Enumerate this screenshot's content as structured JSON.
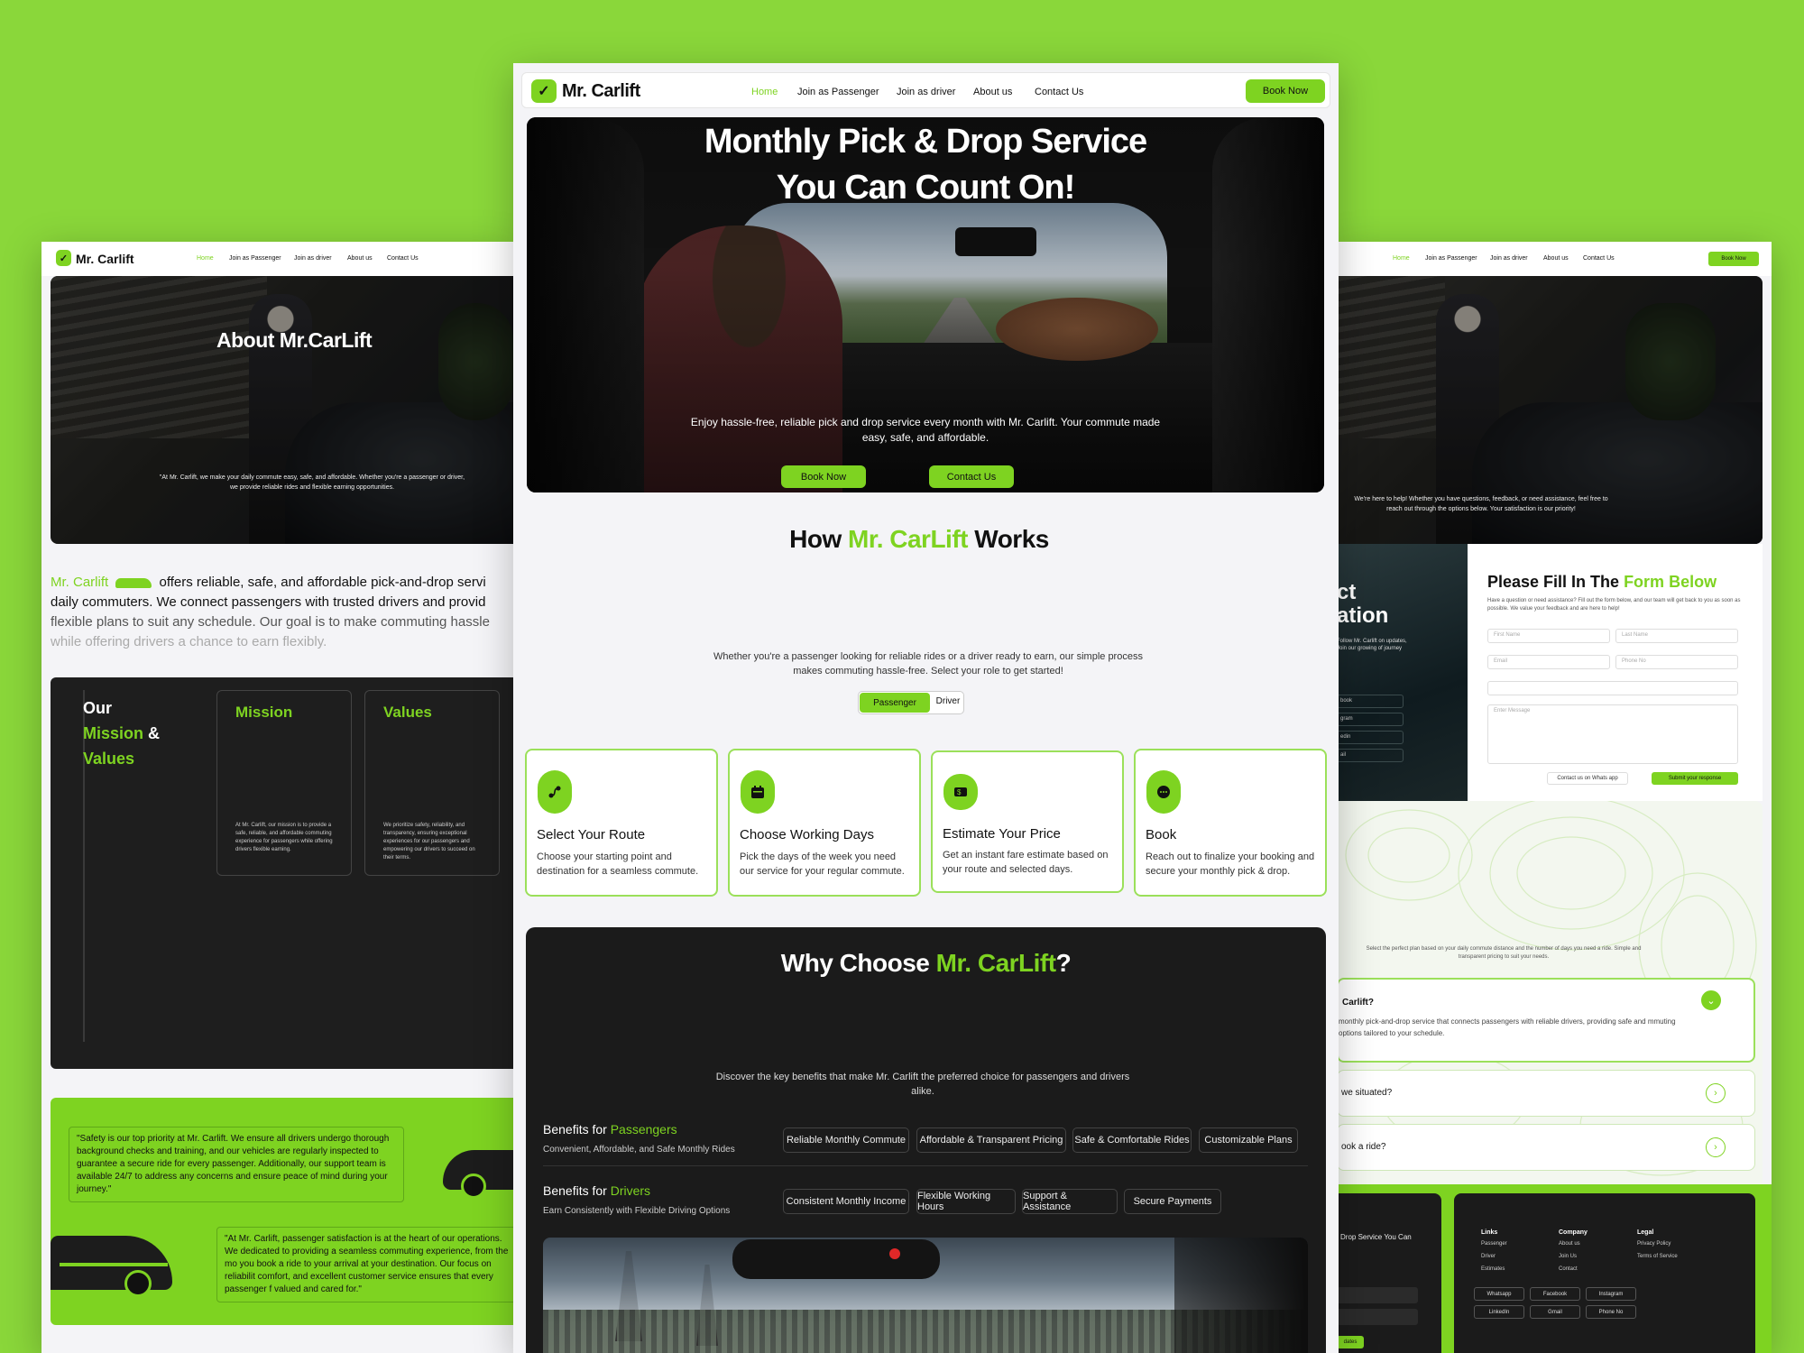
{
  "brand": {
    "name": "Mr. Carlift",
    "accent": "#7ed321",
    "dark": "#1b1b1b"
  },
  "nav": {
    "home": "Home",
    "passenger": "Join as Passenger",
    "driver": "Join as driver",
    "about": "About us",
    "contact": "Contact Us",
    "book": "Book Now"
  },
  "hero": {
    "title_line1": "Monthly Pick & Drop Service",
    "title_line2": "You Can Count On!",
    "subtitle": "Enjoy hassle-free, reliable pick and drop service every month with Mr. Carlift. Your commute made easy, safe, and affordable.",
    "btn_book": "Book Now",
    "btn_contact": "Contact Us"
  },
  "how": {
    "title_a": "How ",
    "title_b": "Mr. CarLift",
    "title_c": " Works",
    "desc": "Whether you're a passenger looking for reliable rides or a driver ready to earn, our simple process makes commuting hassle-free. Select your role to get started!",
    "toggle_passenger": "Passenger",
    "toggle_driver": "Driver",
    "steps": [
      {
        "title": "Select Your Route",
        "text": "Choose your starting point and destination for a seamless commute.",
        "icon": "route-icon"
      },
      {
        "title": "Choose Working Days",
        "text": "Pick the days of the week you need our service for your regular commute.",
        "icon": "calendar-icon"
      },
      {
        "title": "Estimate Your Price",
        "text": "Get an instant fare estimate based on your route and selected days.",
        "icon": "price-icon"
      },
      {
        "title": "Book",
        "text": "Reach out to finalize your booking and secure your monthly pick & drop.",
        "icon": "chat-icon"
      }
    ]
  },
  "why": {
    "title_a": "Why Choose ",
    "title_b": "Mr. CarLift",
    "title_c": "?",
    "desc": "Discover the key benefits that make Mr. Carlift the preferred choice for passengers and drivers alike.",
    "passengers_label_a": "Benefits for ",
    "passengers_label_b": "Passengers",
    "passengers_sub": "Convenient, Affordable, and Safe Monthly Rides",
    "passengers_pills": [
      "Reliable Monthly Commute",
      "Affordable & Transparent Pricing",
      "Safe & Comfortable Rides",
      "Customizable Plans"
    ],
    "drivers_label_a": "Benefits for ",
    "drivers_label_b": "Drivers",
    "drivers_sub": "Earn Consistently with Flexible Driving Options",
    "drivers_pills": [
      "Consistent Monthly Income",
      "Flexible Working Hours",
      "Support & Assistance",
      "Secure Payments"
    ]
  },
  "about": {
    "title": "About Mr.CarLift",
    "hero_text": "\"At Mr. Carlift, we make your daily commute easy, safe, and affordable. Whether you're a passenger or driver, we provide reliable rides and flexible earning opportunities.",
    "intro_brand": "Mr. Carlift",
    "intro_l1": "offers reliable, safe, and affordable pick-and-drop servi",
    "intro_l2": "daily commuters. We connect passengers with trusted drivers and provid",
    "intro_l3": "flexible plans to suit any schedule. Our goal is to make commuting hassle",
    "intro_l4": "while offering drivers a chance to earn flexibly.",
    "mv_our": "Our",
    "mv_mission": "Mission",
    "mv_amp": "&",
    "mv_values": "Values",
    "mission_title": "Mission",
    "mission_text": "At Mr. Carlift, our mission is to provide a safe, reliable, and affordable commuting experience for passengers while offering drivers flexible earning.",
    "values_title": "Values",
    "values_text": "We prioritize safety, reliability, and transparency, ensuring exceptional experiences for our passengers and empowering our drivers to succeed on their terms.",
    "quote1": "\"Safety is our top priority at Mr. Carlift. We ensure all drivers undergo thorough background checks and training, and our vehicles are regularly inspected to guarantee a secure ride for every passenger. Additionally, our support team is available 24/7 to address any concerns and ensure peace of mind during your journey.\"",
    "quote2": "\"At Mr. Carlift, passenger satisfaction is at the heart of our operations. We dedicated to providing a seamless commuting experience, from the mo you book a ride to your arrival at your destination. Our focus on reliabilit comfort, and excellent customer service ensures that every passenger f valued and cared for.\""
  },
  "contact": {
    "hero_text": "We're here to help! Whether you have questions, feedback, or need assistance, feel free to reach out through the options below. Your satisfaction is our priority!",
    "side_title_1": "ct",
    "side_title_2": "ation",
    "side_text": "Follow Mr. Carlift on updates, Join our growing of journey",
    "side_links": [
      "book",
      "gram",
      "edin",
      "ail"
    ],
    "form_title_a": "Please Fill In The ",
    "form_title_b": "Form Below",
    "form_desc": "Have a question or need assistance? Fill out the form below, and our team will get back to you as soon as possible. We value your feedback and are here to help!",
    "ph_first": "First Name",
    "ph_last": "Last Name",
    "ph_email": "Email",
    "ph_phone": "Phone No",
    "ph_message": "Enter Message",
    "btn_whatsapp": "Contact us on Whats app",
    "btn_submit": "Submit your response",
    "pricing_text": "Select the perfect plan based on your daily commute distance and the number of days you need a ride. Simple and transparent pricing to suit your needs.",
    "faq1_q": "Carlift?",
    "faq1_a": "monthly pick-and-drop service that connects passengers with reliable drivers, providing safe and mmuting options tailored to your schedule.",
    "faq2_q": "we situated?",
    "faq3_q": "ook a ride?",
    "footer_tag": "Drop Service You Can",
    "footer_cols": [
      {
        "title": "Links",
        "items": [
          "Passenger",
          "Driver",
          "Estimates"
        ]
      },
      {
        "title": "Company",
        "items": [
          "About us",
          "Join Us",
          "Contact"
        ]
      },
      {
        "title": "Legal",
        "items": [
          "Privacy Policy",
          "Terms of Service"
        ]
      }
    ],
    "social_row1": [
      "Whatsapp",
      "Facebook",
      "Instagram"
    ],
    "social_row2": [
      "LinkedIn",
      "Gmail",
      "Phone No"
    ],
    "footer_btn": "dates"
  }
}
